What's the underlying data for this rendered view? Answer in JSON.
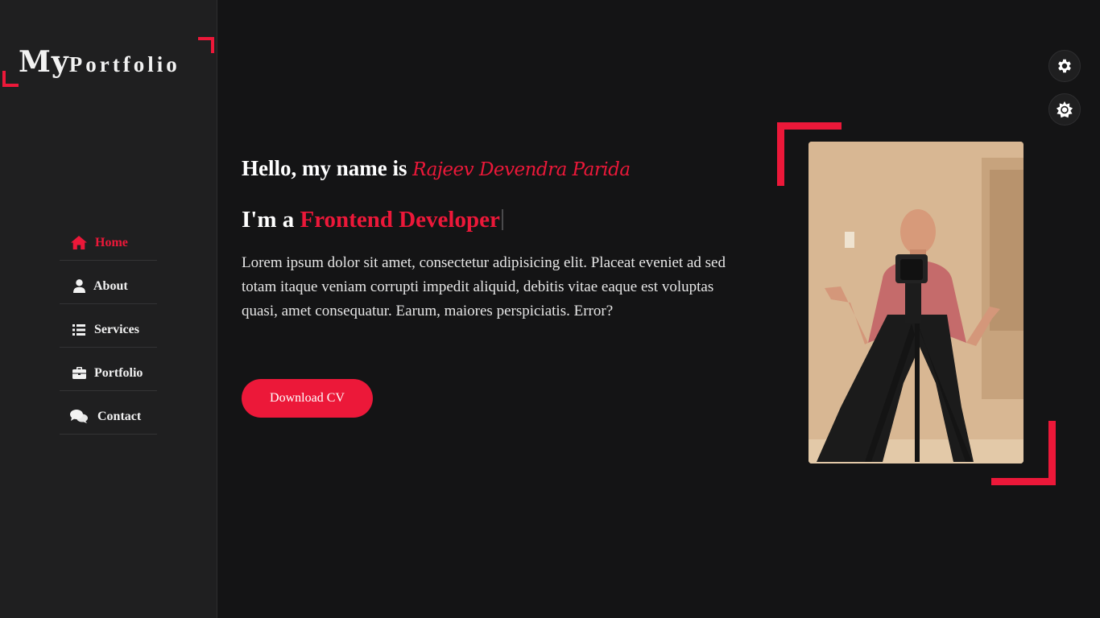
{
  "logo": {
    "prefix": "My",
    "suffix": "Portfolio"
  },
  "nav": {
    "items": [
      {
        "label": "Home",
        "icon": "home-icon",
        "active": true
      },
      {
        "label": "About",
        "icon": "user-icon",
        "active": false
      },
      {
        "label": "Services",
        "icon": "list-icon",
        "active": false
      },
      {
        "label": "Portfolio",
        "icon": "briefcase-icon",
        "active": false
      },
      {
        "label": "Contact",
        "icon": "comments-icon",
        "active": false
      }
    ]
  },
  "hero": {
    "greeting": "Hello, my name is",
    "name": "Rajeev Devendra Parida",
    "role_prefix": "I'm a",
    "role": "Frontend Developer",
    "description": "Lorem ipsum dolor sit amet, consectetur adipisicing elit. Placeat eveniet ad sed totam itaque veniam corrupti impedit aliquid, debitis vitae eaque est voluptas quasi, amet consequatur. Earum, maiores perspiciatis. Error?",
    "button_label": "Download CV"
  },
  "photo": {
    "alt": "profile-photo"
  },
  "controls": {
    "style_switcher_icon": "gear-icon",
    "day_night_icon": "sun-icon"
  },
  "colors": {
    "accent": "#ec1839",
    "background": "#141415",
    "sidebar": "#1f1f20"
  }
}
